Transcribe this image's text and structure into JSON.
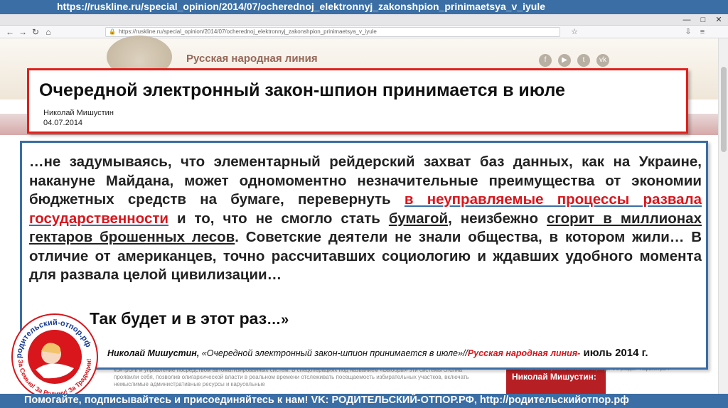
{
  "top_banner": {
    "url_text": "https://ruskline.ru/special_opinion/2014/07/ocherednoj_elektronnyj_zakonshpion_prinimaetsya_v_iyule"
  },
  "browser": {
    "address": "https://ruskline.ru/special_opinion/2014/07/ocherednoj_elektronnyj_zakonshpion_prinimaetsya_v_iyule",
    "window_controls": {
      "minimize": "—",
      "maximize": "□",
      "close": "✕"
    }
  },
  "site": {
    "name": "Русская народная линия",
    "social_icons": [
      "f",
      "▶",
      "t",
      "vk"
    ]
  },
  "article": {
    "title": "Очередной электронный закон-шпион принимается в июле",
    "author": "Николай Мишустин",
    "date": "04.07.2014"
  },
  "quote": {
    "part1": "…не задумываясь, что элементарный рейдерский захват баз данных, как на Украине, накануне Майдана, может одномоментно незначительные преимущества от экономии бюджетных средств на бумаге, перевернуть ",
    "highlight": "в неуправляемые процессы развала государственности",
    "part2": " и то, что не смогло стать ",
    "underline1": "бумагой",
    "part3": ", неизбежно ",
    "underline2": "сгорит в миллионах гектаров брошенных лесов",
    "part4": ". Советские деятели не знали общества, в котором жили… В отличие от американцев, точно рассчитавших социологию и ждавших удобного момента для развала целой цивилизации…",
    "last_line": "Так будет и в этот раз",
    "last_tail": "…»"
  },
  "citation": {
    "author": "Николай Мишустин,",
    "source": " «Очередной электронный закон-шпион принимается в июле»//",
    "site": "Русская народная линия-",
    "date": " июль 2014 г."
  },
  "background_page": {
    "text": "контроль и управление посредством автоматизированных систем. В спецоперациях под названием «Выборы» эти системы сполна проявили себя, позволив олигархической власти в реальном времени отслеживать посещаемость избирательных участков, включать немыслимые административные ресурсы и карусельные",
    "side_box": "Николай Мишустин:",
    "activate_note": "Чтобы активировать Windows, перейдите в раздел \"Параметры\"."
  },
  "logo": {
    "text_top": "родительский-отпор.рф",
    "text_bottom": "За Семью! За Родину! За Традиции!"
  },
  "bottom_banner": {
    "text": "Помогайте, подписывайтесь и присоединяйтесь к нам! VK: РОДИТЕЛЬСКИЙ-ОТПОР.РФ, http://родительскийотпор.рф"
  },
  "colors": {
    "banner_blue": "#3a6ea5",
    "title_red": "#e0201b",
    "highlight_red": "#d8161c"
  }
}
